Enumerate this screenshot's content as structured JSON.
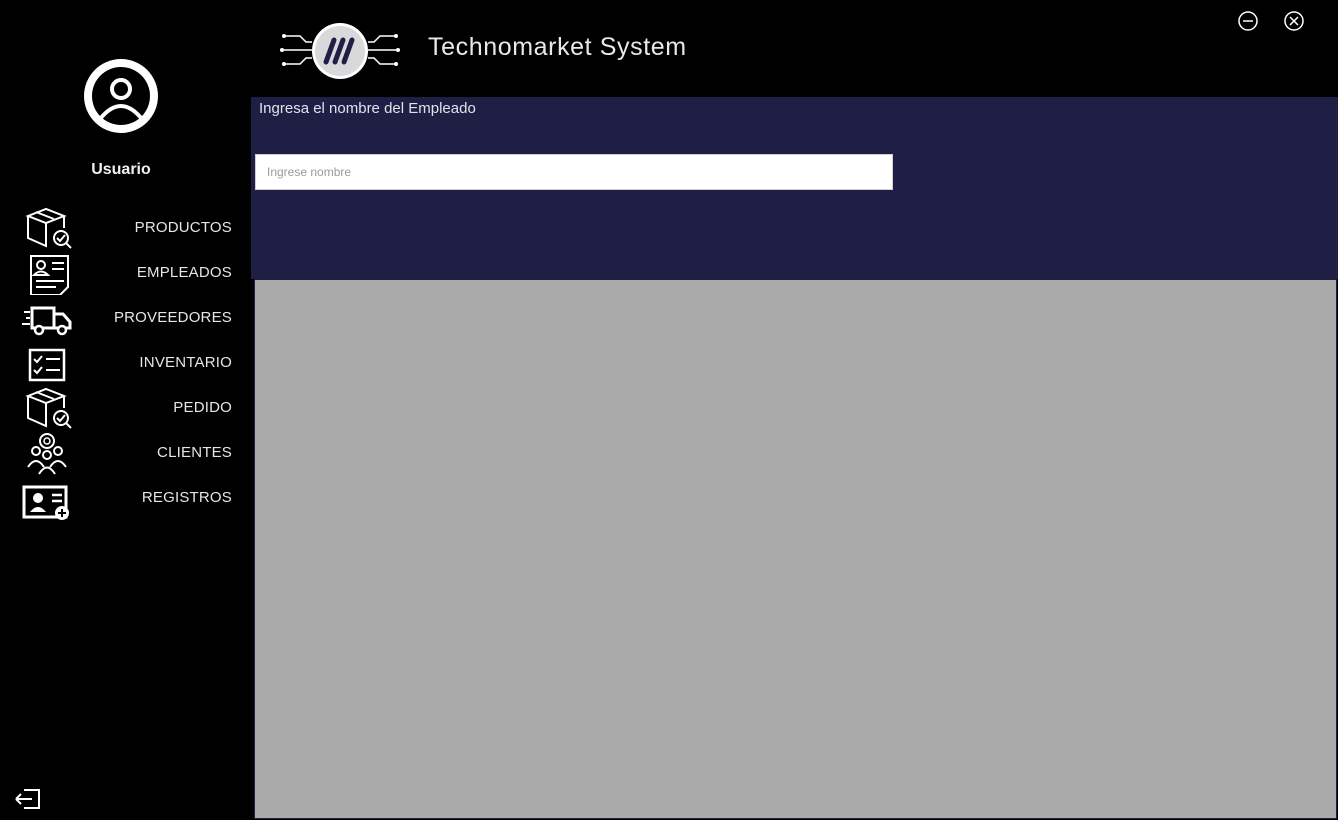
{
  "app": {
    "title": "Technomarket System"
  },
  "user": {
    "name": "Usuario"
  },
  "sidebar": {
    "items": [
      {
        "label": "PRODUCTOS",
        "icon": "box-search-icon"
      },
      {
        "label": "EMPLEADOS",
        "icon": "employee-document-icon"
      },
      {
        "label": "PROVEEDORES",
        "icon": "delivery-truck-icon"
      },
      {
        "label": "INVENTARIO",
        "icon": "checklist-icon"
      },
      {
        "label": "PEDIDO",
        "icon": "box-search-icon"
      },
      {
        "label": "CLIENTES",
        "icon": "customers-group-icon"
      },
      {
        "label": "REGISTROS",
        "icon": "user-card-add-icon"
      }
    ]
  },
  "panel": {
    "prompt": "Ingresa el nombre del Empleado",
    "search": {
      "placeholder": "Ingrese nombre",
      "value": ""
    }
  },
  "colors": {
    "sidebar_bg": "#000000",
    "panel_bg": "#1f1f46",
    "grid_bg": "#aaaaaa",
    "accent_text": "#e6e6e6"
  }
}
